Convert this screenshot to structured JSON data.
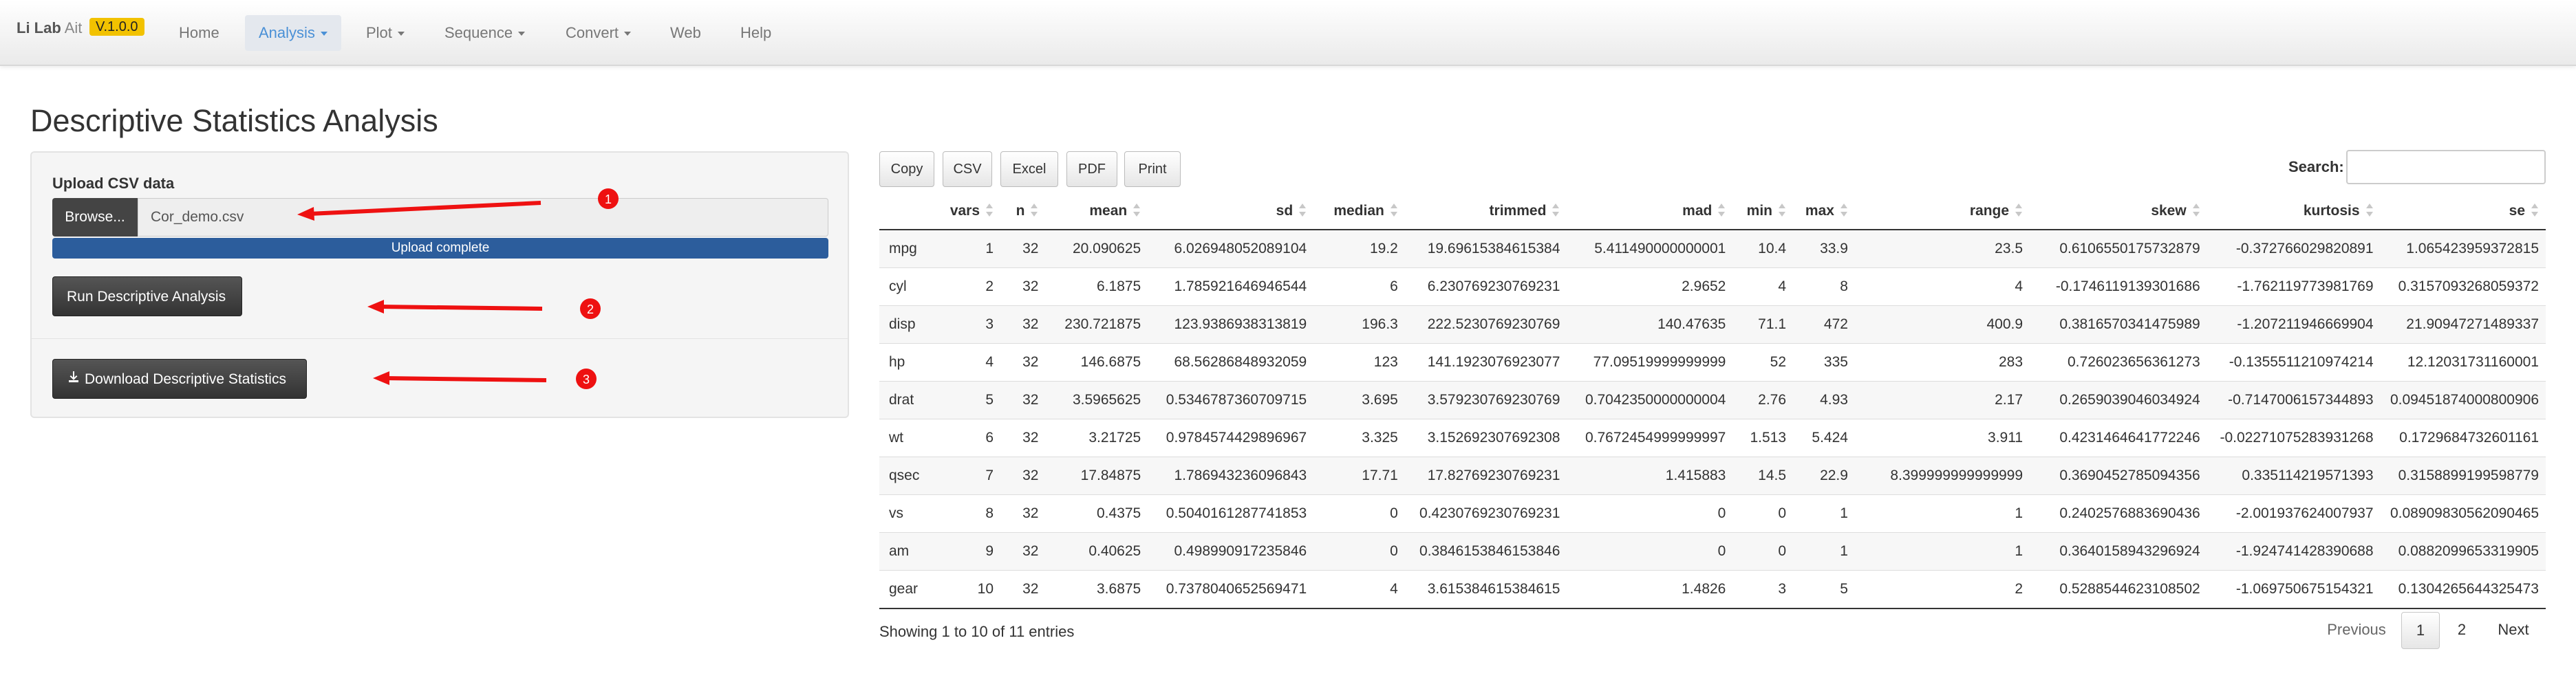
{
  "navbar": {
    "brand_bold": "Li Lab",
    "brand_light": "Ait",
    "version": "V.1.0.0",
    "items": [
      {
        "label": "Home"
      },
      {
        "label": "Analysis"
      },
      {
        "label": "Plot"
      },
      {
        "label": "Sequence"
      },
      {
        "label": "Convert"
      },
      {
        "label": "Web"
      },
      {
        "label": "Help"
      }
    ],
    "active_item": "Analysis"
  },
  "page": {
    "title": "Descriptive Statistics Analysis"
  },
  "upload": {
    "label": "Upload CSV data",
    "browse_label": "Browse...",
    "file_name": "Cor_demo.csv",
    "progress_text": "Upload complete",
    "progress_value": 1.0,
    "progress_color": "#2c5d9c"
  },
  "actions": {
    "run_label": "Run Descriptive Analysis",
    "download_label": "Download Descriptive Statistics",
    "download_icon": "download-icon"
  },
  "annotations": {
    "color": "#ee1111",
    "markers": [
      "1",
      "2",
      "3"
    ]
  },
  "table": {
    "buttons": [
      "Copy",
      "CSV",
      "Excel",
      "PDF",
      "Print"
    ],
    "search_label": "Search:",
    "columns": [
      "",
      "vars",
      "n",
      "mean",
      "sd",
      "median",
      "trimmed",
      "mad",
      "min",
      "max",
      "range",
      "skew",
      "kurtosis",
      "se"
    ],
    "rows": [
      [
        "mpg",
        "1",
        "32",
        "20.090625",
        "6.026948052089104",
        "19.2",
        "19.69615384615384",
        "5.411490000000001",
        "10.4",
        "33.9",
        "23.5",
        "0.6106550175732879",
        "-0.372766029820891",
        "1.065423959372815"
      ],
      [
        "cyl",
        "2",
        "32",
        "6.1875",
        "1.785921646946544",
        "6",
        "6.230769230769231",
        "2.9652",
        "4",
        "8",
        "4",
        "-0.1746119139301686",
        "-1.762119773981769",
        "0.3157093268059372"
      ],
      [
        "disp",
        "3",
        "32",
        "230.721875",
        "123.9386938313819",
        "196.3",
        "222.5230769230769",
        "140.47635",
        "71.1",
        "472",
        "400.9",
        "0.3816570341475989",
        "-1.207211946669904",
        "21.90947271489337"
      ],
      [
        "hp",
        "4",
        "32",
        "146.6875",
        "68.56286848932059",
        "123",
        "141.1923076923077",
        "77.09519999999999",
        "52",
        "335",
        "283",
        "0.726023656361273",
        "-0.1355511210974214",
        "12.12031731160001"
      ],
      [
        "drat",
        "5",
        "32",
        "3.5965625",
        "0.5346787360709715",
        "3.695",
        "3.579230769230769",
        "0.7042350000000004",
        "2.76",
        "4.93",
        "2.17",
        "0.2659039046034924",
        "-0.7147006157344893",
        "0.09451874000800906"
      ],
      [
        "wt",
        "6",
        "32",
        "3.21725",
        "0.9784574429896967",
        "3.325",
        "3.152692307692308",
        "0.7672454999999997",
        "1.513",
        "5.424",
        "3.911",
        "0.4231464641772246",
        "-0.02271075283931268",
        "0.1729684732601161"
      ],
      [
        "qsec",
        "7",
        "32",
        "17.84875",
        "1.786943236096843",
        "17.71",
        "17.82769230769231",
        "1.415883",
        "14.5",
        "22.9",
        "8.399999999999999",
        "0.3690452785094356",
        "0.335114219571393",
        "0.3158899199598779"
      ],
      [
        "vs",
        "8",
        "32",
        "0.4375",
        "0.5040161287741853",
        "0",
        "0.4230769230769231",
        "0",
        "0",
        "1",
        "1",
        "0.2402576883690436",
        "-2.001937624007937",
        "0.08909830562090465"
      ],
      [
        "am",
        "9",
        "32",
        "0.40625",
        "0.498990917235846",
        "0",
        "0.3846153846153846",
        "0",
        "0",
        "1",
        "1",
        "0.3640158943296924",
        "-1.924741428390688",
        "0.0882099653319905"
      ],
      [
        "gear",
        "10",
        "32",
        "3.6875",
        "0.7378040652569471",
        "4",
        "3.615384615384615",
        "1.4826",
        "3",
        "5",
        "2",
        "0.5288544623108502",
        "-1.069750675154321",
        "0.1304265644325473"
      ]
    ],
    "info": "Showing 1 to 10 of 11 entries",
    "pagination": {
      "prev": "Previous",
      "pages": [
        "1",
        "2"
      ],
      "current": "1",
      "next": "Next"
    }
  }
}
